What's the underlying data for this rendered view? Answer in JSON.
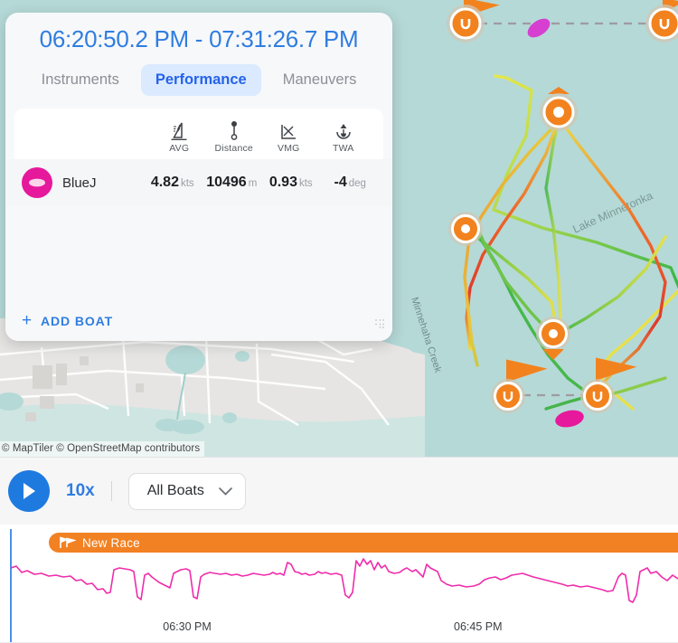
{
  "panel": {
    "title": "06:20:50.2 PM - 07:31:26.7 PM",
    "tabs": [
      {
        "label": "Instruments",
        "active": false
      },
      {
        "label": "Performance",
        "active": true
      },
      {
        "label": "Maneuvers",
        "active": false
      }
    ],
    "columns": [
      {
        "label": "AVG",
        "icon": "sailboat-icon"
      },
      {
        "label": "Distance",
        "icon": "distance-pin-icon"
      },
      {
        "label": "VMG",
        "icon": "vmg-chart-icon"
      },
      {
        "label": "TWA",
        "icon": "twa-arrow-icon"
      }
    ],
    "boats": [
      {
        "name": "BlueJ",
        "color": "#e6189c",
        "avg": {
          "value": "4.82",
          "unit": "kts"
        },
        "distance": {
          "value": "10496",
          "unit": "m"
        },
        "vmg": {
          "value": "0.93",
          "unit": "kts"
        },
        "twa": {
          "value": "-4",
          "unit": "deg"
        }
      }
    ],
    "add_boat_label": "ADD BOAT",
    "add_boat_plus": "+",
    "accent_color": "#2f7de1",
    "active_tab_bg": "#dbeafe"
  },
  "map": {
    "attribution": "© MapTiler © OpenStreetMap contributors",
    "labels": [
      {
        "text": "Lake Minnetonka"
      },
      {
        "text": "Minnehaha Creek"
      }
    ],
    "water_color": "#b5d9d7",
    "land_color": "#e6e5e3",
    "marker_color": "#f2821e",
    "boat_color": "#e6189c"
  },
  "controls": {
    "play_icon": "play-icon",
    "speed": "10x",
    "boat_filter": "All Boats",
    "chevron_icon": "chevron-down-icon"
  },
  "timeline": {
    "race_label": "New Race",
    "race_icon": "race-flags-icon",
    "race_bar_color": "#f28123",
    "trace_color": "#ef2cab",
    "playhead_color": "#4a90e8",
    "axis_ticks": [
      {
        "label": "06:30 PM",
        "x_pct": 27.6
      },
      {
        "label": "06:45 PM",
        "x_pct": 70.5
      }
    ]
  }
}
